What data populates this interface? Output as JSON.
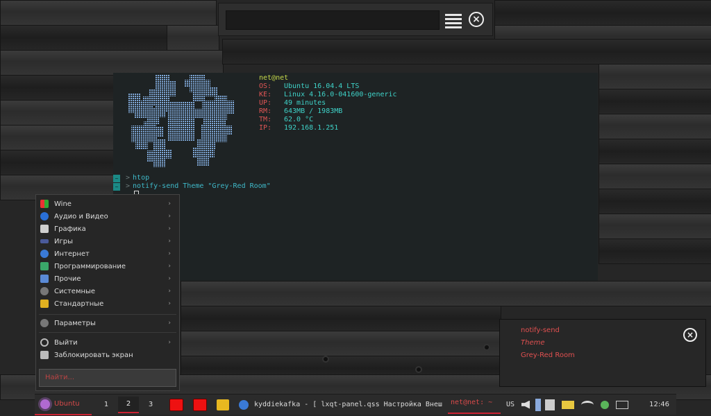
{
  "top_bar": {},
  "terminal": {
    "user_host": "net@net",
    "info": [
      {
        "key": "OS:",
        "value": "Ubuntu 16.04.4 LTS"
      },
      {
        "key": "KE:",
        "value": "Linux 4.16.0-041600-generic"
      },
      {
        "key": "UP:",
        "value": "49 minutes"
      },
      {
        "key": "RM:",
        "value": "643MB / 1983MB"
      },
      {
        "key": "TM:",
        "value": "62.0 °C"
      },
      {
        "key": "IP:",
        "value": "192.168.1.251"
      }
    ],
    "commands": [
      {
        "prompt": "~",
        "text": "htop"
      },
      {
        "prompt": "~",
        "text": "notify-send Theme \"Grey-Red Room\""
      }
    ]
  },
  "start_menu": {
    "items": [
      {
        "label": "Wine",
        "icon": "wine-icon",
        "color": "#3aa0ff"
      },
      {
        "label": "Аудио и Видео",
        "icon": "media-icon",
        "color": "#2a6fd6"
      },
      {
        "label": "Графика",
        "icon": "graphics-icon",
        "color": "#cfcfcf"
      },
      {
        "label": "Игры",
        "icon": "games-icon",
        "color": "#4a5a9a"
      },
      {
        "label": "Интернет",
        "icon": "internet-icon",
        "color": "#3a7ad6"
      },
      {
        "label": "Программирование",
        "icon": "programming-icon",
        "color": "#3aa86a"
      },
      {
        "label": "Прочие",
        "icon": "other-icon",
        "color": "#5a8ad6"
      },
      {
        "label": "Системные",
        "icon": "system-icon",
        "color": "#777777"
      },
      {
        "label": "Стандартные",
        "icon": "accessories-icon",
        "color": "#e0b020"
      }
    ],
    "settings_label": "Параметры",
    "logout_label": "Выйти",
    "lock_label": "Заблокировать экран",
    "search_placeholder": "Найти..."
  },
  "notification": {
    "title": "notify-send",
    "summary": "Theme",
    "body": "Grey-Red Room"
  },
  "taskbar": {
    "start_label": "Ubuntu",
    "workspaces": [
      "1",
      "2",
      "3"
    ],
    "active_workspace": "2",
    "window_title": "kyddiekafka - [ lxqt-panel.qss  Настройка Внеш",
    "terminal_task": "net@net: ~",
    "keyboard_layout": "US",
    "clock": "12:46"
  },
  "colors": {
    "accent": "#cc2233",
    "terminal_value": "#3fd3c9",
    "terminal_key": "#e05555"
  }
}
